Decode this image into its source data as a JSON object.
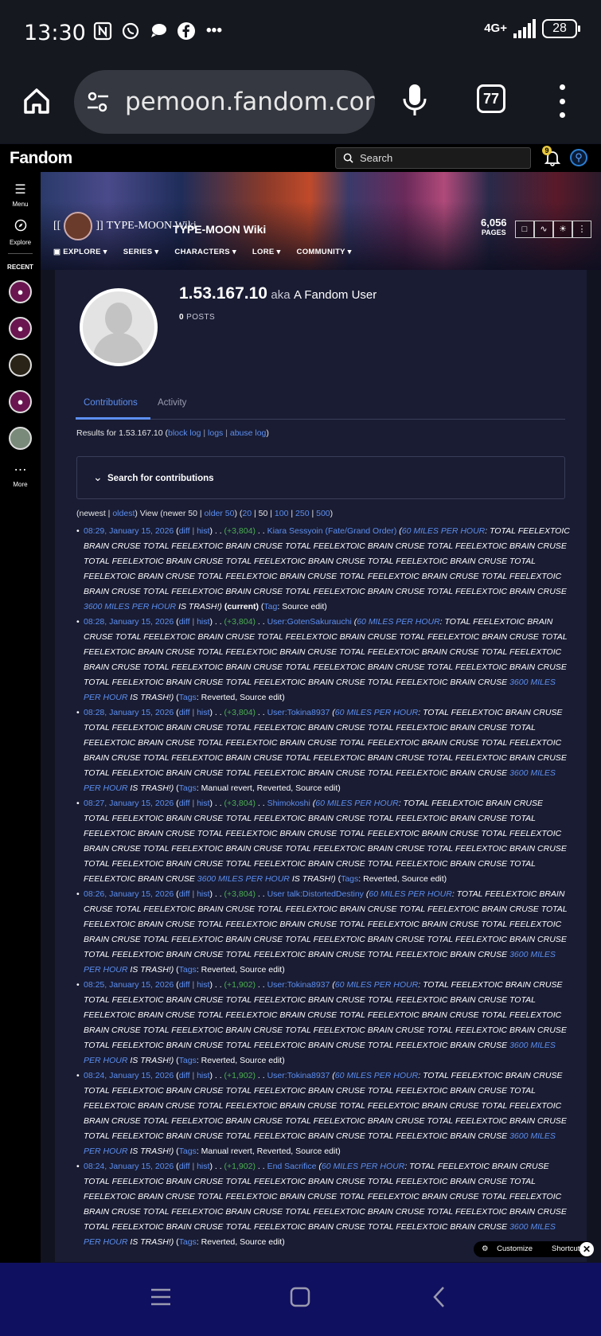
{
  "status_bar": {
    "time": "13:30",
    "network": "4G+",
    "battery": "28",
    "overflow": "•••"
  },
  "browser": {
    "url": "pemoon.fandom.com",
    "tab_count": "77"
  },
  "fandom": {
    "logo": "Fandom",
    "search_placeholder": "Search",
    "notification_count": "9"
  },
  "rail": {
    "menu_label": "Menu",
    "explore_label": "Explore",
    "recent_label": "RECENT",
    "more_label": "More"
  },
  "wiki": {
    "logo_text": "TYPE-MOON Wiki",
    "name": "TYPE-MOON Wiki",
    "pages_count": "6,056",
    "pages_label": "PAGES",
    "nav": [
      "EXPLORE",
      "SERIES",
      "CHARACTERS",
      "LORE",
      "COMMUNITY"
    ]
  },
  "profile": {
    "ip": "1.53.167.10",
    "aka": "aka",
    "fandom_user": "A Fandom User",
    "posts_count": "0",
    "posts_label": "POSTS"
  },
  "tabs": {
    "contributions": "Contributions",
    "activity": "Activity"
  },
  "results": {
    "prefix": "Results for 1.53.167.10 (",
    "block_log": "block log",
    "logs": "logs",
    "abuse_log": "abuse log",
    "suffix": ")"
  },
  "search_section": {
    "label": "Search for contributions"
  },
  "pager": {
    "newest": "(newest |",
    "oldest": "oldest",
    "view": ") View (newer 50 |",
    "older": "older 50",
    "mid": ") (",
    "n20": "20",
    "n50": "| 50 |",
    "n100": "100",
    "n250": "250",
    "n500": "500",
    "end": ")"
  },
  "text": {
    "diff": "diff",
    "hist": "hist",
    "dots": ". .",
    "speed_tag": "60 MILES PER HOUR",
    "trash_tag": "3600 MILES PER HOUR",
    "trash_suffix": "IS TRASH!)",
    "current": "(current)",
    "tag_label": "Tag",
    "tags_label": "Tags"
  },
  "contributions": [
    {
      "timestamp": "08:29, January 15, 2026",
      "size": "(+3,804)",
      "page": "Kiara Sessyoin (Fate/Grand Order)",
      "lead": ": TOTAL",
      "body": "FEELEXTOIC BRAIN CRUSE TOTAL FEELEXTOIC BRAIN CRUSE TOTAL FEELEXTOIC BRAIN CRUSE TOTAL FEELEXTOIC BRAIN CRUSE TOTAL FEELEXTOIC BRAIN CRUSE TOTAL FEELEXTOIC BRAIN CRUSE TOTAL FEELEXTOIC BRAIN CRUSE TOTAL FEELEXTOIC BRAIN CRUSE TOTAL FEELEXTOIC BRAIN CRUSE TOTAL FEELEXTOIC BRAIN CRUSE TOTAL FEELEXTOIC BRAIN CRUSE TOTAL FEELEXTOIC BRAIN CRUSE TOTAL FEELEXTOIC BRAIN CRUSE TOTAL FEELEXTOIC BRAIN CRUSE",
      "tag_suffix": ": Source edit)",
      "current": true,
      "single_tag": true
    },
    {
      "timestamp": "08:28, January 15, 2026",
      "size": "(+3,804)",
      "page": "User:GotenSakurauchi",
      "lead": ": TOTAL FEELEXTOIC",
      "body": "BRAIN CRUSE TOTAL FEELEXTOIC BRAIN CRUSE TOTAL FEELEXTOIC BRAIN CRUSE TOTAL FEELEXTOIC BRAIN CRUSE TOTAL FEELEXTOIC BRAIN CRUSE TOTAL FEELEXTOIC BRAIN CRUSE TOTAL FEELEXTOIC BRAIN CRUSE TOTAL FEELEXTOIC BRAIN CRUSE TOTAL FEELEXTOIC BRAIN CRUSE TOTAL FEELEXTOIC BRAIN CRUSE TOTAL FEELEXTOIC BRAIN CRUSE TOTAL FEELEXTOIC BRAIN CRUSE TOTAL FEELEXTOIC BRAIN CRUSE TOTAL FEELEXTOIC BRAIN CRUSE",
      "tag_suffix": ": Reverted, Source edit)"
    },
    {
      "timestamp": "08:28, January 15, 2026",
      "size": "(+3,804)",
      "page": "User:Tokina8937",
      "lead": ": TOTAL FEELEXTOIC BRAIN",
      "body": "CRUSE TOTAL FEELEXTOIC BRAIN CRUSE TOTAL FEELEXTOIC BRAIN CRUSE TOTAL FEELEXTOIC BRAIN CRUSE TOTAL FEELEXTOIC BRAIN CRUSE TOTAL FEELEXTOIC BRAIN CRUSE TOTAL FEELEXTOIC BRAIN CRUSE TOTAL FEELEXTOIC BRAIN CRUSE TOTAL FEELEXTOIC BRAIN CRUSE TOTAL FEELEXTOIC BRAIN CRUSE TOTAL FEELEXTOIC BRAIN CRUSE TOTAL FEELEXTOIC BRAIN CRUSE TOTAL FEELEXTOIC BRAIN CRUSE TOTAL FEELEXTOIC BRAIN CRUSE",
      "tag_suffix": ": Manual revert, Reverted, Source edit)"
    },
    {
      "timestamp": "08:27, January 15, 2026",
      "size": "(+3,804)",
      "page": "Shimokoshi",
      "lead": ": TOTAL FEELEXTOIC BRAIN CRUSE",
      "body": "TOTAL FEELEXTOIC BRAIN CRUSE TOTAL FEELEXTOIC BRAIN CRUSE TOTAL FEELEXTOIC BRAIN CRUSE TOTAL FEELEXTOIC BRAIN CRUSE TOTAL FEELEXTOIC BRAIN CRUSE TOTAL FEELEXTOIC BRAIN CRUSE TOTAL FEELEXTOIC BRAIN CRUSE TOTAL FEELEXTOIC BRAIN CRUSE TOTAL FEELEXTOIC BRAIN CRUSE TOTAL FEELEXTOIC BRAIN CRUSE TOTAL FEELEXTOIC BRAIN CRUSE TOTAL FEELEXTOIC BRAIN CRUSE TOTAL FEELEXTOIC BRAIN CRUSE TOTAL FEELEXTOIC BRAIN CRUSE",
      "tag_suffix": ": Reverted, Source edit)"
    },
    {
      "timestamp": "08:26, January 15, 2026",
      "size": "(+3,804)",
      "page": "User talk:DistortedDestiny",
      "lead": ": TOTAL FEELEXTOIC",
      "body": "BRAIN CRUSE TOTAL FEELEXTOIC BRAIN CRUSE TOTAL FEELEXTOIC BRAIN CRUSE TOTAL FEELEXTOIC BRAIN CRUSE TOTAL FEELEXTOIC BRAIN CRUSE TOTAL FEELEXTOIC BRAIN CRUSE TOTAL FEELEXTOIC BRAIN CRUSE TOTAL FEELEXTOIC BRAIN CRUSE TOTAL FEELEXTOIC BRAIN CRUSE TOTAL FEELEXTOIC BRAIN CRUSE TOTAL FEELEXTOIC BRAIN CRUSE TOTAL FEELEXTOIC BRAIN CRUSE TOTAL FEELEXTOIC BRAIN CRUSE TOTAL FEELEXTOIC BRAIN CRUSE",
      "tag_suffix": ": Reverted, Source edit)"
    },
    {
      "timestamp": "08:25, January 15, 2026",
      "size": "(+1,902)",
      "page": "User:Tokina8937",
      "lead": ": TOTAL FEELEXTOIC BRAIN",
      "body": "CRUSE TOTAL FEELEXTOIC BRAIN CRUSE TOTAL FEELEXTOIC BRAIN CRUSE TOTAL FEELEXTOIC BRAIN CRUSE TOTAL FEELEXTOIC BRAIN CRUSE TOTAL FEELEXTOIC BRAIN CRUSE TOTAL FEELEXTOIC BRAIN CRUSE TOTAL FEELEXTOIC BRAIN CRUSE TOTAL FEELEXTOIC BRAIN CRUSE TOTAL FEELEXTOIC BRAIN CRUSE TOTAL FEELEXTOIC BRAIN CRUSE TOTAL FEELEXTOIC BRAIN CRUSE TOTAL FEELEXTOIC BRAIN CRUSE TOTAL FEELEXTOIC BRAIN CRUSE",
      "tag_suffix": ": Reverted, Source edit)"
    },
    {
      "timestamp": "08:24, January 15, 2026",
      "size": "(+1,902)",
      "page": "User:Tokina8937",
      "lead": ": TOTAL FEELEXTOIC BRAIN",
      "body": "CRUSE TOTAL FEELEXTOIC BRAIN CRUSE TOTAL FEELEXTOIC BRAIN CRUSE TOTAL FEELEXTOIC BRAIN CRUSE TOTAL FEELEXTOIC BRAIN CRUSE TOTAL FEELEXTOIC BRAIN CRUSE TOTAL FEELEXTOIC BRAIN CRUSE TOTAL FEELEXTOIC BRAIN CRUSE TOTAL FEELEXTOIC BRAIN CRUSE TOTAL FEELEXTOIC BRAIN CRUSE TOTAL FEELEXTOIC BRAIN CRUSE TOTAL FEELEXTOIC BRAIN CRUSE TOTAL FEELEXTOIC BRAIN CRUSE TOTAL FEELEXTOIC BRAIN CRUSE",
      "tag_suffix": ": Manual revert, Reverted, Source edit)"
    },
    {
      "timestamp": "08:24, January 15, 2026",
      "size": "(+1,902)",
      "page": "End Sacrifice",
      "lead": ": TOTAL FEELEXTOIC BRAIN",
      "body": "CRUSE TOTAL FEELEXTOIC BRAIN CRUSE TOTAL FEELEXTOIC BRAIN CRUSE TOTAL FEELEXTOIC BRAIN CRUSE TOTAL FEELEXTOIC BRAIN CRUSE TOTAL FEELEXTOIC BRAIN CRUSE TOTAL FEELEXTOIC BRAIN CRUSE TOTAL FEELEXTOIC BRAIN CRUSE TOTAL FEELEXTOIC BRAIN CRUSE TOTAL FEELEXTOIC BRAIN CRUSE TOTAL FEELEXTOIC BRAIN CRUSE TOTAL FEELEXTOIC BRAIN CRUSE TOTAL FEELEXTOIC BRAIN CRUSE TOTAL FEELEXTOIC BRAIN CRUSE",
      "tag_suffix": ": Reverted, Source edit)"
    }
  ],
  "footer": {
    "customize": "Customize",
    "shortcuts": "Shortcuts"
  },
  "colors": {
    "link": "#5d8ff0",
    "positive_diff": "#4caf50",
    "page_bg": "#191c33",
    "fandom_accent": "#fa005a"
  }
}
